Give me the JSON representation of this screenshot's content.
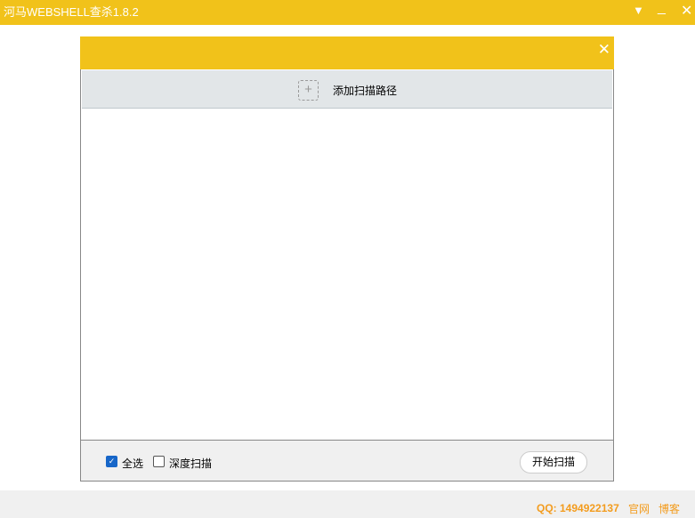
{
  "window": {
    "title": "河马WEBSHELL查杀1.8.2"
  },
  "dialog": {
    "add_path_label": "添加扫描路径",
    "select_all_label": "全选",
    "select_all_checked": true,
    "deep_scan_label": "深度扫描",
    "deep_scan_checked": false,
    "start_label": "开始扫描"
  },
  "footer": {
    "qq": "QQ: 1494922137",
    "website": "官网",
    "blog": "博客"
  },
  "colors": {
    "brand": "#f1c21a",
    "link": "#f39c1e",
    "check": "#1766c8"
  }
}
